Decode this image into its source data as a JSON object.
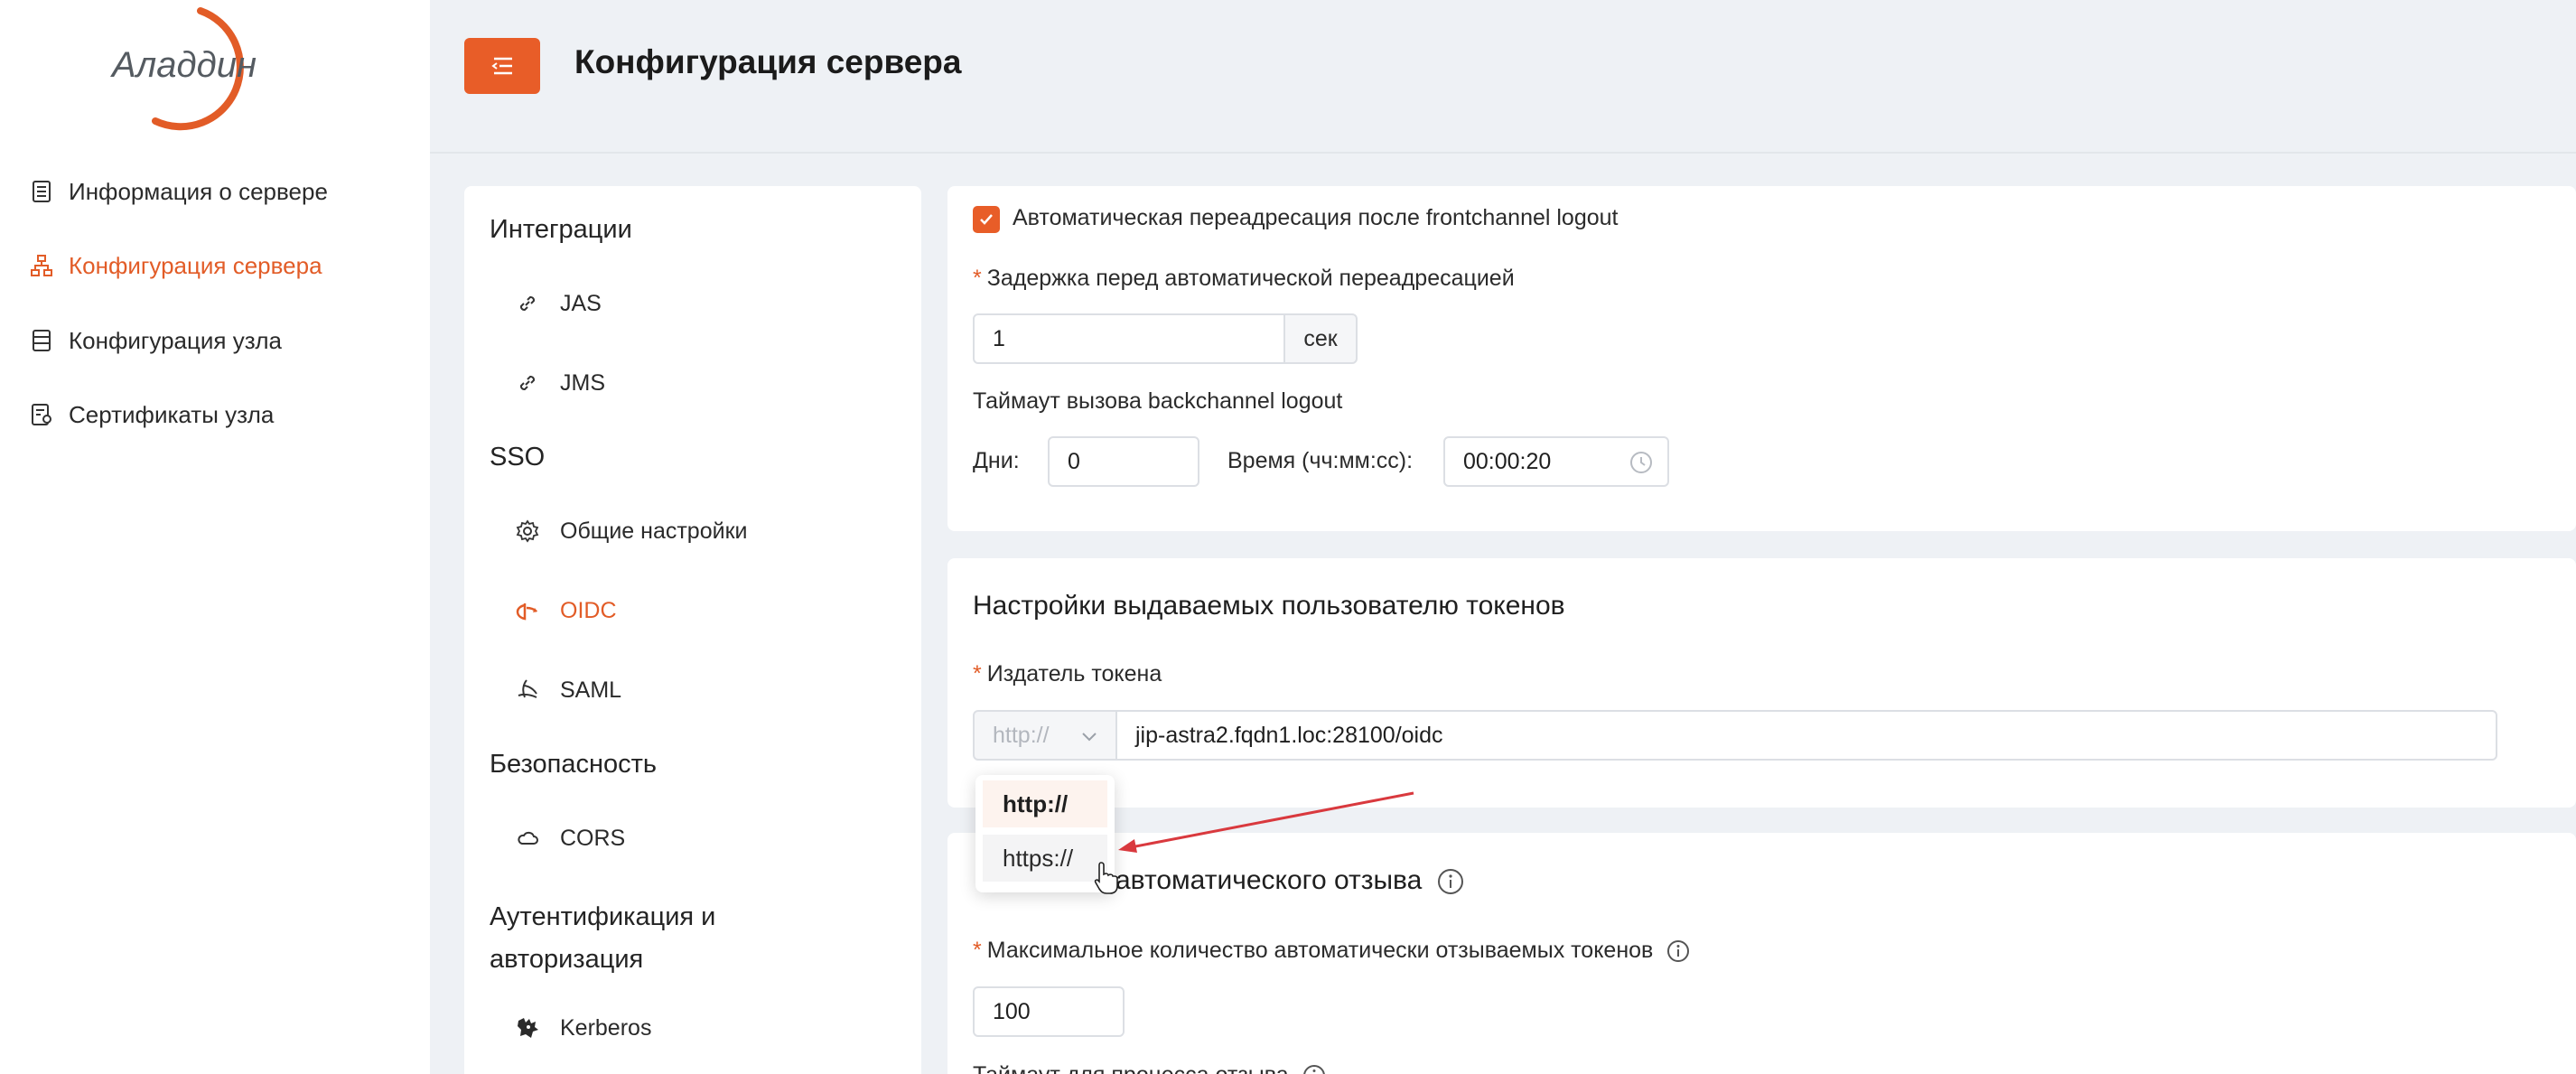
{
  "brand": {
    "logo_text": "Аладдин",
    "accent": "#E85D28"
  },
  "nav": {
    "items": [
      {
        "label": "Информация о сервере",
        "icon": "server-list-icon",
        "active": false
      },
      {
        "label": "Конфигурация сервера",
        "icon": "sitemap-icon",
        "active": true
      },
      {
        "label": "Конфигурация узла",
        "icon": "database-icon",
        "active": false
      },
      {
        "label": "Сертификаты узла",
        "icon": "certificate-icon",
        "active": false
      }
    ]
  },
  "header": {
    "menu_toggle_icon": "menu-fold-icon",
    "title": "Конфигурация сервера"
  },
  "integrations": {
    "sections": [
      {
        "title": "Интеграции",
        "items": [
          {
            "label": "JAS",
            "icon": "link-icon"
          },
          {
            "label": "JMS",
            "icon": "link-icon"
          }
        ]
      },
      {
        "title": "SSO",
        "items": [
          {
            "label": "Общие настройки",
            "icon": "gear-icon"
          },
          {
            "label": "OIDC",
            "icon": "openid-icon",
            "active": true
          },
          {
            "label": "SAML",
            "icon": "saml-icon"
          }
        ]
      },
      {
        "title": "Безопасность",
        "items": [
          {
            "label": "CORS",
            "icon": "cloud-icon"
          }
        ]
      },
      {
        "title_line1": "Аутентификация и",
        "title_line2": "авторизация",
        "items": [
          {
            "label": "Kerberos",
            "icon": "kerberos-icon"
          }
        ]
      }
    ]
  },
  "logout": {
    "auto_redirect_label": "Автоматическая переадресация после frontchannel logout",
    "auto_redirect_checked": true,
    "delay_label": "Задержка перед автоматической переадресацией",
    "delay_value": "1",
    "delay_unit": "сек",
    "timeout_label": "Таймаут вызова backchannel logout",
    "days_label": "Дни:",
    "days_value": "0",
    "time_label": "Время (чч:мм:сс):",
    "time_value": "00:00:20"
  },
  "tokens": {
    "title": "Настройки выдаваемых пользователю токенов",
    "issuer_label": "Издатель токена",
    "scheme_value": "http://",
    "issuer_value": "jip-astra2.fqdn1.loc:28100/oidc",
    "scheme_options": [
      "http://",
      "https://"
    ],
    "scheme_selected": "http://"
  },
  "revoke": {
    "title": "автоматического отзыва",
    "max_label": "Максимальное количество автоматически отзываемых токенов",
    "max_value": "100",
    "timeout_label": "Таймаут для процесса отзыва"
  }
}
